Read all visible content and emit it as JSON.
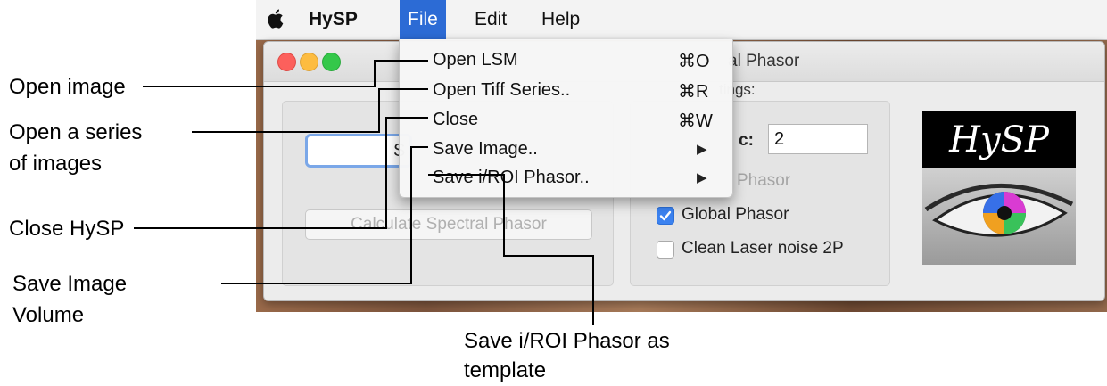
{
  "menubar": {
    "apple_icon": "apple-logo-icon",
    "items": [
      {
        "label": "HySP"
      },
      {
        "label": "File"
      },
      {
        "label": "Edit"
      },
      {
        "label": "Help"
      }
    ]
  },
  "file_menu": {
    "items": [
      {
        "label": "Open LSM",
        "shortcut": "⌘O"
      },
      {
        "label": "Open Tiff Series..",
        "shortcut": "⌘R"
      },
      {
        "label": "Close",
        "shortcut": "⌘W"
      },
      {
        "label": "Save Image..",
        "submenu_arrow": "▶"
      },
      {
        "label": "Save i/ROI Phasor..",
        "submenu_arrow": "▶"
      }
    ]
  },
  "window": {
    "title_fragment": "al Phasor",
    "settings_fragment": "tings:",
    "left_field_fragment": "S",
    "calculate_button": "Calculate Spectral Phasor",
    "harmonic_label_fragment": "c:",
    "harmonic_value": "2",
    "phasor_fragment": "Phasor",
    "global_phasor": {
      "label": "Global Phasor",
      "checked": true
    },
    "clean_laser": {
      "label": "Clean Laser noise 2P",
      "checked": false
    },
    "logo_text": "HySP"
  },
  "annotations": {
    "open_image": "Open image",
    "open_series_line1": "Open a series",
    "open_series_line2": "of images",
    "close_hysp": "Close HySP",
    "save_image_line1": "Save Image",
    "save_image_line2": "Volume",
    "save_phasor_line1": "Save i/ROI Phasor as",
    "save_phasor_line2": "template"
  },
  "colors": {
    "menu_highlight": "#2c6bd5",
    "checkbox_blue": "#3b82f0",
    "traffic_red": "#fc605c",
    "traffic_yellow": "#fdbc40",
    "traffic_green": "#34c84a"
  }
}
